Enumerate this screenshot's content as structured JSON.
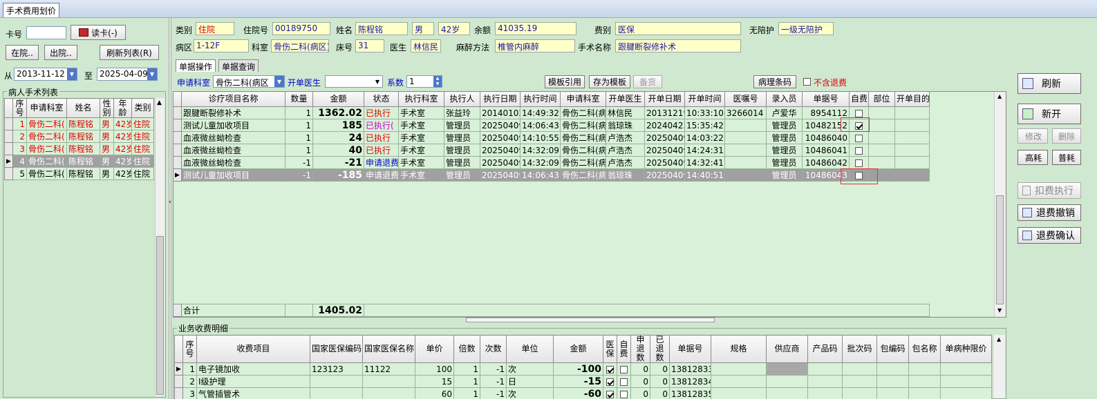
{
  "window": {
    "tab_title": "手术费用划价"
  },
  "left": {
    "card_label": "卡号",
    "card_value": "",
    "read_card_btn": "读卡(-)",
    "in_hospital_btn": "在院..",
    "out_hospital_btn": "出院..",
    "refresh_list_btn": "刷新列表(R)",
    "from_label": "从",
    "from_date": "2013-11-12",
    "to_label": "至",
    "to_date": "2025-04-09",
    "list_title": "病人手术列表",
    "columns": [
      "序号",
      "申请科室",
      "姓名",
      "性别",
      "年龄",
      "类别"
    ],
    "rows": [
      {
        "no": "1",
        "dept": "骨伤二科(",
        "name": "陈程铭",
        "sex": "男",
        "age": "42岁",
        "type": "住院",
        "color": "red"
      },
      {
        "no": "2",
        "dept": "骨伤二科(",
        "name": "陈程铭",
        "sex": "男",
        "age": "42岁",
        "type": "住院",
        "color": "red"
      },
      {
        "no": "3",
        "dept": "骨伤二科(",
        "name": "陈程铭",
        "sex": "男",
        "age": "42岁",
        "type": "住院",
        "color": "red"
      },
      {
        "no": "4",
        "dept": "骨伤二科(",
        "name": "陈程铭",
        "sex": "男",
        "age": "42岁",
        "type": "住院",
        "color": "sel"
      },
      {
        "no": "5",
        "dept": "骨伤二科(",
        "name": "陈程铭",
        "sex": "男",
        "age": "42岁",
        "type": "住院",
        "color": "black"
      }
    ]
  },
  "patient": {
    "type_label": "类别",
    "type": "住院",
    "inpatient_no_label": "住院号",
    "inpatient_no": "00189750",
    "name_label": "姓名",
    "name": "陈程铭",
    "sex": "男",
    "age": "42岁",
    "balance_label": "余额",
    "balance": "41035.19",
    "fee_type_label": "费别",
    "fee_type": "医保",
    "escort_label": "无陪护",
    "escort": "一级无陪护",
    "ward_label": "病区",
    "ward": "1-12F",
    "dept_label": "科室",
    "dept": "骨伤二科(病区)",
    "bed_label": "床号",
    "bed": "31",
    "doctor_label": "医生",
    "doctor": "林信民",
    "anesthesia_label": "麻醉方法",
    "anesthesia": "椎管内麻醉",
    "surgery_label": "手术名称",
    "surgery": "跟腱断裂修补术"
  },
  "tabs": [
    "单据操作",
    "单据查询"
  ],
  "toolbar": {
    "apply_dept_label": "申请科室",
    "apply_dept": "骨伤二科(病区",
    "order_doctor_label": "开单医生",
    "order_doctor": "",
    "coef_label": "系数",
    "coef": "1",
    "template_ref_btn": "模板引用",
    "save_template_btn": "存为模板",
    "stock_btn": "备货",
    "pathology_btn": "病理条码",
    "no_refund_label": "不含退费"
  },
  "main_grid": {
    "columns": [
      "诊疗项目名称",
      "数量",
      "金额",
      "状态",
      "执行科室",
      "执行人",
      "执行日期",
      "执行时间",
      "申请科室",
      "开单医生",
      "开单日期",
      "开单时间",
      "医嘱号",
      "录入员",
      "单据号",
      "自费",
      "部位",
      "开单目的"
    ],
    "rows": [
      {
        "item": "跟腱断裂修补术",
        "qty": "1",
        "amount": "1362.02",
        "status": "已执行",
        "status_color": "red",
        "exec_dept": "手术室",
        "executor": "张益玲",
        "exec_date": "20140102",
        "exec_time": "14:49:32",
        "apply_dept": "骨伤二科(病",
        "doctor": "林信民",
        "order_date": "20131219",
        "order_time": "10:33:10",
        "order_no": "3266014",
        "entry": "卢爱华",
        "bill_no": "8954112",
        "self_pay": false
      },
      {
        "item": "测试儿童加收项目",
        "qty": "1",
        "amount": "185",
        "status": "已执行(",
        "status_color": "mag",
        "exec_dept": "手术室",
        "executor": "管理员",
        "exec_date": "20250409",
        "exec_time": "14:06:43",
        "apply_dept": "骨伤二科(病",
        "doctor": "翁琼珠",
        "order_date": "20240423",
        "order_time": "15:35:42",
        "order_no": "",
        "entry": "管理员",
        "bill_no": "10482152",
        "self_pay": true
      },
      {
        "item": "血液微丝蚴检查",
        "qty": "1",
        "amount": "24",
        "status": "已执行",
        "status_color": "red",
        "exec_dept": "手术室",
        "executor": "管理员",
        "exec_date": "20250409",
        "exec_time": "14:10:55",
        "apply_dept": "骨伤二科(病",
        "doctor": "卢浩杰",
        "order_date": "20250409",
        "order_time": "14:03:22",
        "order_no": "",
        "entry": "管理员",
        "bill_no": "10486040",
        "self_pay": false
      },
      {
        "item": "血液微丝蚴检查",
        "qty": "1",
        "amount": "40",
        "status": "已执行",
        "status_color": "red",
        "exec_dept": "手术室",
        "executor": "管理员",
        "exec_date": "20250409",
        "exec_time": "14:32:09",
        "apply_dept": "骨伤二科(病",
        "doctor": "卢浩杰",
        "order_date": "20250409",
        "order_time": "14:24:31",
        "order_no": "",
        "entry": "管理员",
        "bill_no": "10486041",
        "self_pay": false
      },
      {
        "item": "血液微丝蚴检查",
        "qty": "-1",
        "amount": "-21",
        "status": "申请退费",
        "status_color": "blue",
        "exec_dept": "手术室",
        "executor": "管理员",
        "exec_date": "20250409",
        "exec_time": "14:32:09",
        "apply_dept": "骨伤二科(病",
        "doctor": "卢浩杰",
        "order_date": "20250409",
        "order_time": "14:32:41",
        "order_no": "",
        "entry": "管理员",
        "bill_no": "10486042",
        "self_pay": false
      },
      {
        "item": "测试儿童加收项目",
        "qty": "-1",
        "amount": "-185",
        "status": "申请退费",
        "status_color": "sel",
        "exec_dept": "手术室",
        "executor": "管理员",
        "exec_date": "20250409",
        "exec_time": "14:06:43",
        "apply_dept": "骨伤二科(病",
        "doctor": "翁琼珠",
        "order_date": "20250409",
        "order_time": "14:40:51",
        "order_no": "",
        "entry": "管理员",
        "bill_no": "10486043",
        "self_pay": false
      }
    ],
    "total_label": "合计",
    "total": "1405.02"
  },
  "right_buttons": {
    "refresh": "刷新",
    "new": "新开",
    "modify": "修改",
    "delete": "删除",
    "high_consume": "高耗",
    "general_consume": "普耗",
    "deduct_exec": "扣费执行",
    "refund_cancel": "退费撤销",
    "refund_confirm": "退费确认"
  },
  "detail": {
    "title": "业务收费明细",
    "columns": [
      "序号",
      "收费项目",
      "国家医保编码",
      "国家医保名称",
      "单价",
      "倍数",
      "次数",
      "单位",
      "金额",
      "医保",
      "自费",
      "申退数",
      "已退数",
      "单据号",
      "规格",
      "供应商",
      "产品码",
      "批次码",
      "包编码",
      "包名称",
      "单病种限价"
    ],
    "rows": [
      {
        "no": "1",
        "item": "电子镜加收",
        "code": "123123",
        "cname": "11122",
        "price": "100",
        "mult": "1",
        "times": "-1",
        "unit": "次",
        "amount": "-100",
        "ins": true,
        "self": false,
        "apply_ret": "0",
        "ret": "0",
        "bill": "13812833"
      },
      {
        "no": "2",
        "item": "Ⅰ级护理",
        "code": "",
        "cname": "",
        "price": "15",
        "mult": "1",
        "times": "-1",
        "unit": "日",
        "amount": "-15",
        "ins": true,
        "self": false,
        "apply_ret": "0",
        "ret": "0",
        "bill": "13812834"
      },
      {
        "no": "3",
        "item": "气管插管术",
        "code": "",
        "cname": "",
        "price": "60",
        "mult": "1",
        "times": "-1",
        "unit": "次",
        "amount": "-60",
        "ins": true,
        "self": false,
        "apply_ret": "0",
        "ret": "0",
        "bill": "13812835"
      }
    ]
  }
}
